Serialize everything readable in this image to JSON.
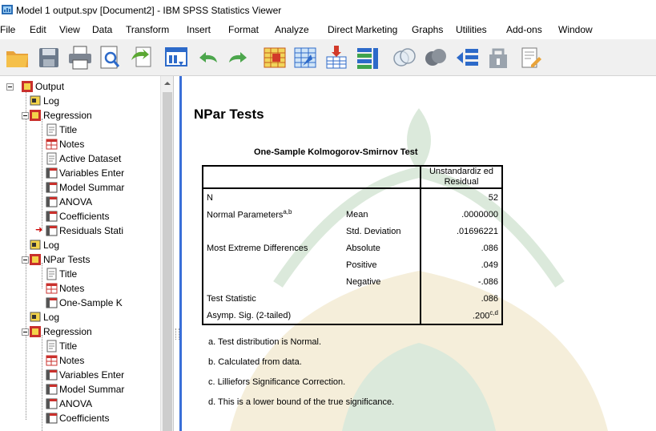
{
  "window": {
    "title": "Model 1 output.spv [Document2] - IBM SPSS Statistics Viewer"
  },
  "menu": [
    {
      "label": "File"
    },
    {
      "label": "Edit"
    },
    {
      "label": "View"
    },
    {
      "label": "Data"
    },
    {
      "label": "Transform"
    },
    {
      "label": "Insert"
    },
    {
      "label": "Format"
    },
    {
      "label": "Analyze"
    },
    {
      "label": "Direct Marketing"
    },
    {
      "label": "Graphs"
    },
    {
      "label": "Utilities"
    },
    {
      "label": "Add-ons"
    },
    {
      "label": "Window"
    }
  ],
  "toolbar": [
    {
      "icon": "open-folder-icon"
    },
    {
      "icon": "save-icon"
    },
    {
      "icon": "print-icon"
    },
    {
      "icon": "print-preview-icon"
    },
    {
      "icon": "export-icon"
    },
    {
      "icon": "recall-dialog-icon"
    },
    {
      "icon": "undo-icon"
    },
    {
      "icon": "redo-icon"
    },
    {
      "icon": "goto-data-icon"
    },
    {
      "icon": "goto-case-icon"
    },
    {
      "icon": "insert-output-icon"
    },
    {
      "icon": "variables-icon"
    },
    {
      "icon": "show-all-icon"
    },
    {
      "icon": "hide-icon"
    },
    {
      "icon": "promote-icon"
    },
    {
      "icon": "demote-icon"
    },
    {
      "icon": "insert-heading-icon"
    }
  ],
  "outline": {
    "root": "Output",
    "items": [
      {
        "label": "Log"
      },
      {
        "label": "Regression"
      },
      {
        "label": "Title"
      },
      {
        "label": "Notes"
      },
      {
        "label": "Active Dataset"
      },
      {
        "label": "Variables Enter"
      },
      {
        "label": "Model Summar"
      },
      {
        "label": "ANOVA"
      },
      {
        "label": "Coefficients"
      },
      {
        "label": "Residuals Stati"
      },
      {
        "label": "Log"
      },
      {
        "label": "NPar Tests"
      },
      {
        "label": "Title"
      },
      {
        "label": "Notes"
      },
      {
        "label": "One-Sample K"
      },
      {
        "label": "Log"
      },
      {
        "label": "Regression"
      },
      {
        "label": "Title"
      },
      {
        "label": "Notes"
      },
      {
        "label": "Variables Enter"
      },
      {
        "label": "Model Summar"
      },
      {
        "label": "ANOVA"
      },
      {
        "label": "Coefficients"
      }
    ]
  },
  "output": {
    "heading": "NPar Tests",
    "table_title": "One-Sample Kolmogorov-Smirnov Test",
    "column_header": "Unstandardiz ed Residual",
    "rows": [
      {
        "label": "N",
        "sub": "",
        "value": "52"
      },
      {
        "label": "Normal Parameters",
        "label_sup": "a,b",
        "sub": "Mean",
        "value": ".0000000"
      },
      {
        "label": "",
        "sub": "Std. Deviation",
        "value": ".01696221"
      },
      {
        "label": "Most Extreme Differences",
        "sub": "Absolute",
        "value": ".086"
      },
      {
        "label": "",
        "sub": "Positive",
        "value": ".049"
      },
      {
        "label": "",
        "sub": "Negative",
        "value": "-.086"
      },
      {
        "label": "Test Statistic",
        "sub": "",
        "value": ".086"
      },
      {
        "label": "Asymp. Sig. (2-tailed)",
        "sub": "",
        "value": ".200",
        "value_sup": "c,d"
      }
    ],
    "footnotes": [
      "a. Test distribution is Normal.",
      "b. Calculated from data.",
      "c. Lilliefors Significance Correction.",
      "d. This is a lower bound of the true significance."
    ]
  }
}
